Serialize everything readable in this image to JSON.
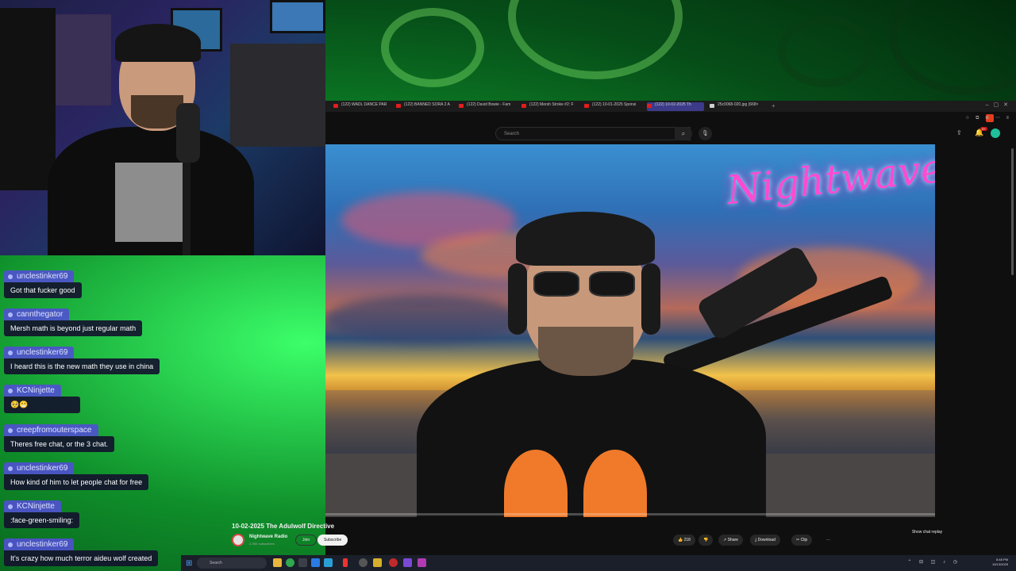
{
  "browser": {
    "tabs": [
      {
        "title": "(122) WADL DANCE PAR",
        "active": false
      },
      {
        "title": "(122) BANNED SORA 2 A",
        "active": false
      },
      {
        "title": "(122) David Bowie - Fam",
        "active": false
      },
      {
        "title": "(122) Mersh Stroke #2: F",
        "active": false
      },
      {
        "title": "(122) 10-01-2025 Sponsi",
        "active": false
      },
      {
        "title": "(122) 10-02-2025 Th",
        "active": true
      },
      {
        "title": "25c0068-020.jpg (668×",
        "active": false
      }
    ],
    "new_tab_label": "+"
  },
  "youtube": {
    "search_placeholder": "Search",
    "notification_count": "9+",
    "video_overlay_logo": "Nightwave",
    "video_title": "10-02-2025 The Adulwolf Directive",
    "channel_name": "Nightwave Radio",
    "subscriber_count": "2.25K subscribers",
    "join_label": "Join",
    "subscribe_label": "Subscribe",
    "like_count": "218",
    "share_label": "Share",
    "download_label": "Download",
    "clip_label": "Clip",
    "more_label": "···",
    "show_chat_replay_label": "Show chat replay"
  },
  "chat": [
    {
      "user": "unclestinker69",
      "text": "Got that fucker good"
    },
    {
      "user": "cannthegator",
      "text": "Mersh math is beyond just regular math"
    },
    {
      "user": "unclestinker69",
      "text": "I heard this is the new math they use in china"
    },
    {
      "user": "KCNinjette",
      "text": "🥺😁"
    },
    {
      "user": "creepfromouterspace",
      "text": "Theres free chat, or the 3 chat."
    },
    {
      "user": "unclestinker69",
      "text": "How kind of him to let people chat for free"
    },
    {
      "user": "KCNinjette",
      "text": ":face-green-smiling:"
    },
    {
      "user": "unclestinker69",
      "text": "It's crazy how much terror aideu wolf created"
    }
  ],
  "taskbar": {
    "search_label": "Search",
    "time": "8:48 PM",
    "date": "10/13/2025"
  },
  "colors": {
    "accent_purple": "#5050d2",
    "youtube_red": "#e21d1d",
    "background_green": "#0f8f2a"
  }
}
